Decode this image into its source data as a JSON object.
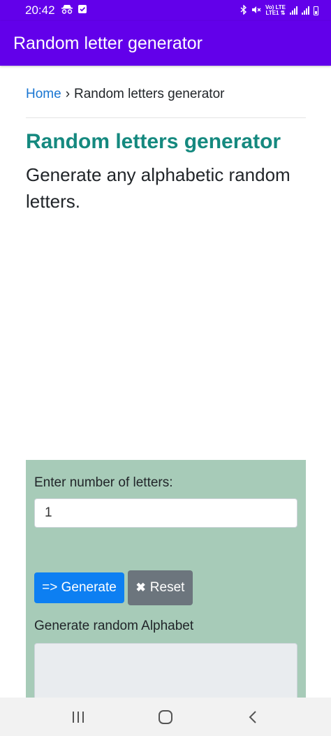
{
  "status_bar": {
    "time": "20:42",
    "left_icons": [
      "incognito-icon",
      "download-check-icon"
    ],
    "right_icons": [
      "bluetooth-icon",
      "mute-icon",
      "volte-lte-icon",
      "signal-icon",
      "signal-icon",
      "battery-icon"
    ],
    "volte_top": "Vo) LTE",
    "volte_bottom": "LTE1 ⇅"
  },
  "app_bar": {
    "title": "Random letter generator"
  },
  "breadcrumb": {
    "home": "Home",
    "separator": "›",
    "current": "Random letters generator"
  },
  "page": {
    "title": "Random letters generator",
    "description": "Generate any alphabetic random letters."
  },
  "tool": {
    "count_label": "Enter number of letters:",
    "count_value": "1",
    "generate_label": "=> Generate",
    "reset_icon": "✖",
    "reset_label": "Reset",
    "output_label": "Generate random Alphabet",
    "output_value": ""
  },
  "nav_bar": {
    "buttons": [
      "recent-apps-icon",
      "home-icon",
      "back-icon"
    ]
  },
  "colors": {
    "app_bar": "#6200ea",
    "title": "#15897f",
    "link": "#1976d2",
    "panel": "#a7cbb8",
    "generate_button": "#0d7ff2",
    "reset_button": "#6c757d",
    "output_box": "#e9ecef"
  }
}
